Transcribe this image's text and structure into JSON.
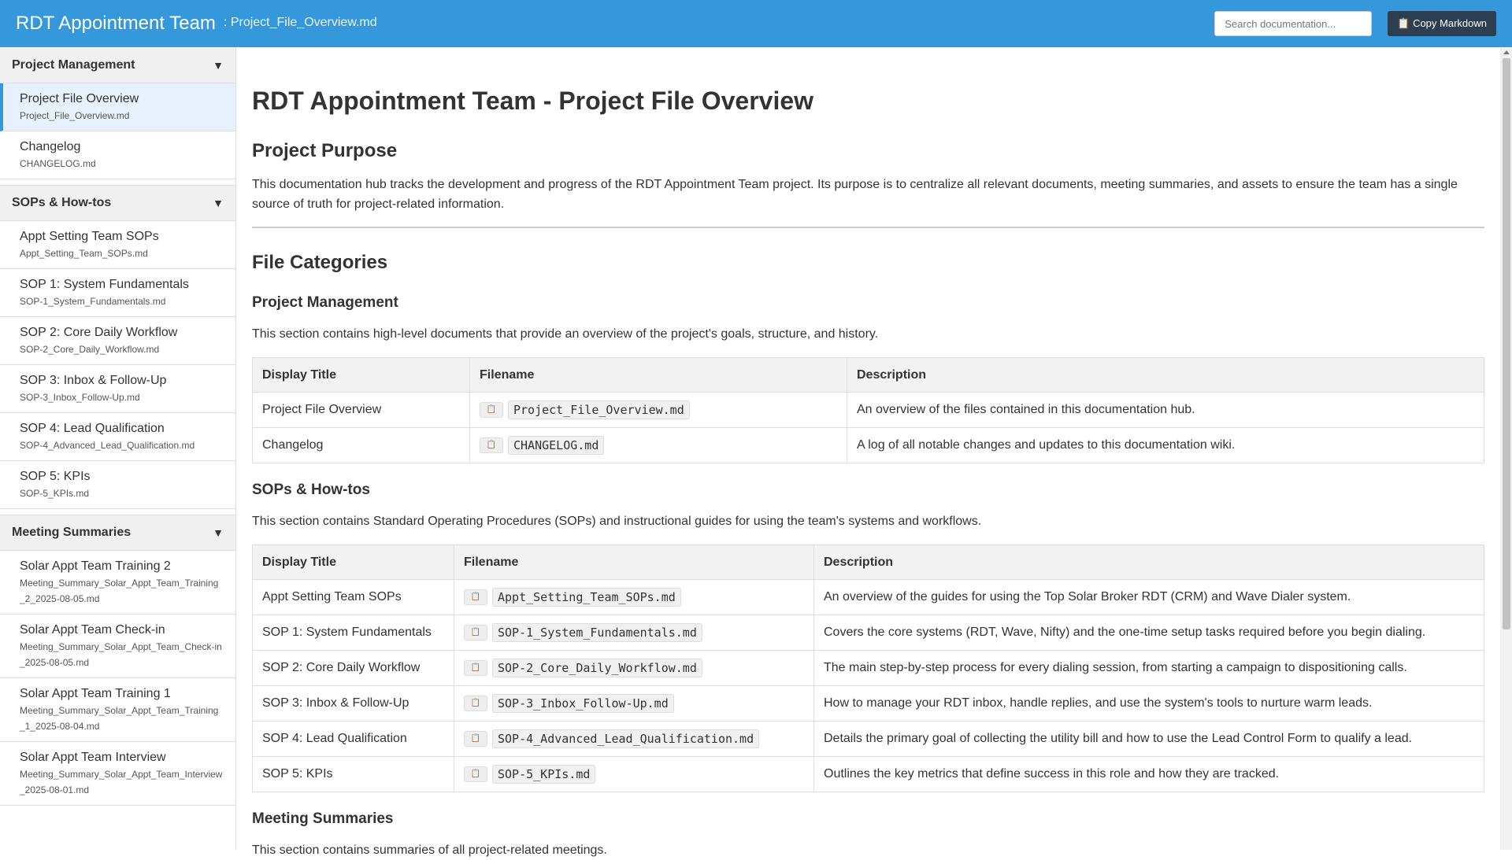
{
  "header": {
    "title": "RDT Appointment Team",
    "breadcrumb": ": Project_File_Overview.md",
    "search_placeholder": "Search documentation...",
    "copy_icon": "clipboard-icon",
    "copy_label": "📋 Copy Markdown",
    "bg_color": "#3498db"
  },
  "sidebar": {
    "groups": [
      {
        "title": "Project Management",
        "caret": "▼",
        "items": [
          {
            "title": "Project File Overview",
            "file": "Project_File_Overview.md",
            "active": true
          },
          {
            "title": "Changelog",
            "file": "CHANGELOG.md"
          }
        ]
      },
      {
        "title": "SOPs & How-tos",
        "caret": "▼",
        "items": [
          {
            "title": "Appt Setting Team SOPs",
            "file": "Appt_Setting_Team_SOPs.md"
          },
          {
            "title": "SOP 1: System Fundamentals",
            "file": "SOP-1_System_Fundamentals.md"
          },
          {
            "title": "SOP 2: Core Daily Workflow",
            "file": "SOP-2_Core_Daily_Workflow.md"
          },
          {
            "title": "SOP 3: Inbox & Follow-Up",
            "file": "SOP-3_Inbox_Follow-Up.md"
          },
          {
            "title": "SOP 4: Lead Qualification",
            "file": "SOP-4_Advanced_Lead_Qualification.md"
          },
          {
            "title": "SOP 5: KPIs",
            "file": "SOP-5_KPIs.md"
          }
        ]
      },
      {
        "title": "Meeting Summaries",
        "caret": "▼",
        "items": [
          {
            "title": "Solar Appt Team Training 2",
            "file": "Meeting_Summary_Solar_Appt_Team_Training_2_2025-08-05.md"
          },
          {
            "title": "Solar Appt Team Check-in",
            "file": "Meeting_Summary_Solar_Appt_Team_Check-in_2025-08-05.md"
          },
          {
            "title": "Solar Appt Team Training 1",
            "file": "Meeting_Summary_Solar_Appt_Team_Training_1_2025-08-04.md"
          },
          {
            "title": "Solar Appt Team Interview",
            "file": "Meeting_Summary_Solar_Appt_Team_Interview_2025-08-01.md"
          }
        ]
      }
    ]
  },
  "main": {
    "h1": "RDT Appointment Team - Project File Overview",
    "purpose_heading": "Project Purpose",
    "purpose_text": "This documentation hub tracks the development and progress of the RDT Appointment Team project. Its purpose is to centralize all relevant documents, meeting summaries, and assets to ensure the team has a single source of truth for project-related information.",
    "categories_heading": "File Categories",
    "pm": {
      "heading": "Project Management",
      "intro": "This section contains high-level documents that provide an overview of the project's goals, structure, and history.",
      "columns": [
        "Display Title",
        "Filename",
        "Description"
      ],
      "rows": [
        {
          "title": "Project File Overview",
          "file": "Project_File_Overview.md",
          "desc": "An overview of the files contained in this documentation hub."
        },
        {
          "title": "Changelog",
          "file": "CHANGELOG.md",
          "desc": "A log of all notable changes and updates to this documentation wiki."
        }
      ]
    },
    "sops": {
      "heading": "SOPs & How-tos",
      "intro": "This section contains Standard Operating Procedures (SOPs) and instructional guides for using the team's systems and workflows.",
      "columns": [
        "Display Title",
        "Filename",
        "Description"
      ],
      "rows": [
        {
          "title": "Appt Setting Team SOPs",
          "file": "Appt_Setting_Team_SOPs.md",
          "desc": "An overview of the guides for using the Top Solar Broker RDT (CRM) and Wave Dialer system."
        },
        {
          "title": "SOP 1: System Fundamentals",
          "file": "SOP-1_System_Fundamentals.md",
          "desc": "Covers the core systems (RDT, Wave, Nifty) and the one-time setup tasks required before you begin dialing."
        },
        {
          "title": "SOP 2: Core Daily Workflow",
          "file": "SOP-2_Core_Daily_Workflow.md",
          "desc": "The main step-by-step process for every dialing session, from starting a campaign to dispositioning calls."
        },
        {
          "title": "SOP 3: Inbox & Follow-Up",
          "file": "SOP-3_Inbox_Follow-Up.md",
          "desc": "How to manage your RDT inbox, handle replies, and use the system's tools to nurture warm leads."
        },
        {
          "title": "SOP 4: Lead Qualification",
          "file": "SOP-4_Advanced_Lead_Qualification.md",
          "desc": "Details the primary goal of collecting the utility bill and how to use the Lead Control Form to qualify a lead."
        },
        {
          "title": "SOP 5: KPIs",
          "file": "SOP-5_KPIs.md",
          "desc": "Outlines the key metrics that define success in this role and how they are tracked."
        }
      ]
    },
    "meetings": {
      "heading": "Meeting Summaries",
      "intro": "This section contains summaries of all project-related meetings."
    },
    "copy_file_icon": "clipboard-icon"
  }
}
